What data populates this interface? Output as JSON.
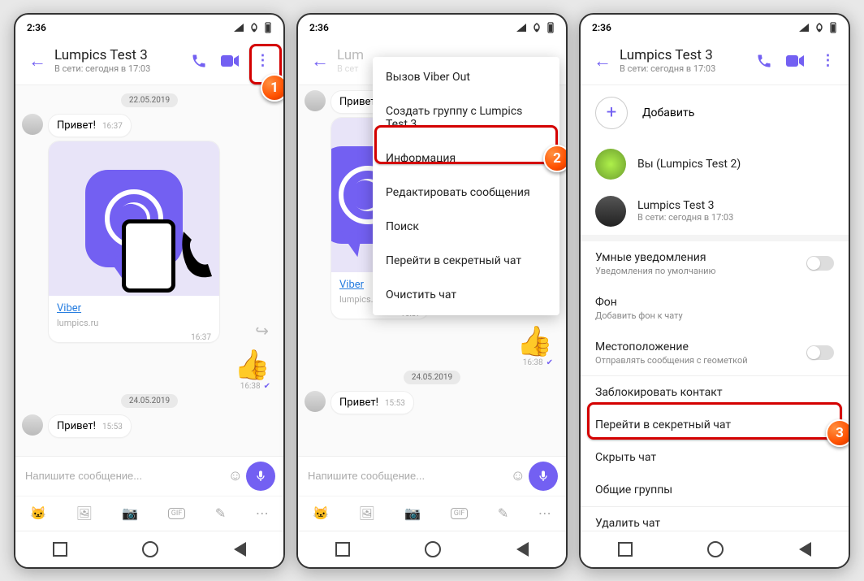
{
  "status": {
    "time": "2:36"
  },
  "chat": {
    "name": "Lumpics Test 3",
    "status": "В сети: сегодня в 17:03",
    "date1": "22.05.2019",
    "msg1": "Привет!",
    "msg1_time": "16:37",
    "link_text": "Viber",
    "link_src": "lumpics.ru",
    "link_time": "16:37",
    "thumb_time": "16:38",
    "date2": "24.05.2019",
    "msg2": "Привет!",
    "msg2_time": "15:53",
    "placeholder": "Напишите сообщение..."
  },
  "menu": {
    "item1": "Вызов Viber Out",
    "item2": "Создать группу с Lumpics Test 3",
    "item3": "Информация",
    "item4": "Редактировать сообщения",
    "item5": "Поиск",
    "item6": "Перейти в секретный чат",
    "item7": "Очистить чат"
  },
  "info": {
    "add": "Добавить",
    "you": "Вы (Lumpics Test 2)",
    "member": "Lumpics Test 3",
    "member_status": "В сети: сегодня в 17:03",
    "smart": "Умные уведомления",
    "smart_sub": "Уведомления по умолчанию",
    "bg": "Фон",
    "bg_sub": "Добавить фон к чату",
    "geo": "Местоположение",
    "geo_sub": "Отправлять сообщения с геометкой",
    "block": "Заблокировать контакт",
    "secret": "Перейти в секретный чат",
    "hide": "Скрыть чат",
    "groups": "Общие группы",
    "delete": "Удалить чат"
  },
  "badges": {
    "b1": "1",
    "b2": "2",
    "b3": "3"
  }
}
